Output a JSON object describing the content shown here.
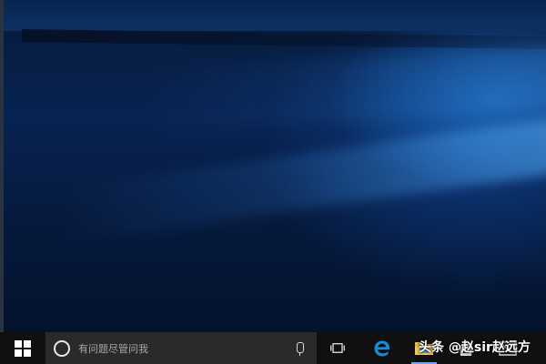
{
  "search": {
    "placeholder": "有问题尽管问我"
  },
  "taskbar": {
    "start_icon": "windows-logo-icon",
    "search_icon": "cortana-circle-icon",
    "mic_icon": "microphone-icon",
    "pinned": [
      {
        "icon": "task-view-icon"
      },
      {
        "icon": "edge-browser-icon"
      },
      {
        "icon": "file-explorer-icon"
      },
      {
        "icon": "store-icon"
      },
      {
        "icon": "mail-icon"
      }
    ]
  },
  "watermark": {
    "text": "头条 @赵sir赵远方"
  },
  "colors": {
    "taskbar": "#101010",
    "search_box": "#2a2a2a",
    "edge_blue": "#1a8ad4",
    "desktop_blue": "#082352"
  }
}
